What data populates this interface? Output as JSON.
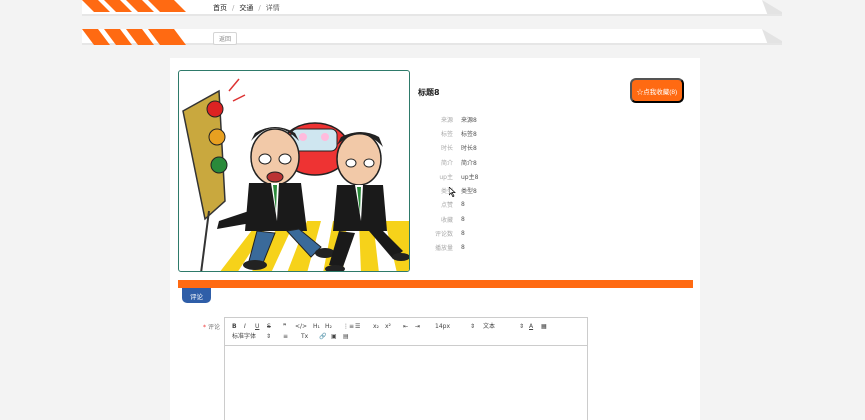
{
  "breadcrumb": {
    "home": "首页",
    "category": "交通",
    "current": "详情"
  },
  "back_label": "返回",
  "item": {
    "title": "标题8",
    "collect_label": "☆点我收藏(8)",
    "fields": [
      {
        "label": "来源",
        "value": "来源8"
      },
      {
        "label": "标签",
        "value": "标签8"
      },
      {
        "label": "时长",
        "value": "时长8"
      },
      {
        "label": "简介",
        "value": "简介8"
      },
      {
        "label": "up主",
        "value": "up主8"
      },
      {
        "label": "类型",
        "value": "类型8"
      },
      {
        "label": "点赞",
        "value": "8"
      },
      {
        "label": "收藏",
        "value": "8"
      },
      {
        "label": "评论数",
        "value": "8"
      },
      {
        "label": "播放量",
        "value": "8"
      }
    ]
  },
  "comment": {
    "tab_label": "评论",
    "field_label": "评论",
    "required_mark": "*"
  },
  "editor_toolbar": {
    "bold": "B",
    "italic": "I",
    "underline": "U",
    "strike": "S",
    "quote": "❞",
    "code": "</>",
    "h1": "H₁",
    "h2": "H₂",
    "ordered_list": "⋮≡",
    "bullet_list": "☰",
    "subscript": "x₂",
    "superscript": "x²",
    "indent_left": "⇤",
    "indent_right": "⇥",
    "font_size": "14px",
    "font_type": "文本",
    "font_color": "A",
    "background_color": "▦",
    "font_family": "标准字体",
    "align": "≡",
    "clear_format": "Tx",
    "link": "🔗",
    "image": "▣",
    "video": "▤"
  },
  "colors": {
    "accent": "#ff6a12",
    "tab": "#2f5ea8"
  }
}
